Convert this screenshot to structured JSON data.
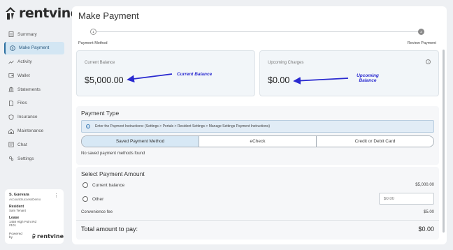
{
  "brand": {
    "name": "rentvine",
    "accent": "#2c6fa0"
  },
  "sidebar": {
    "items": [
      {
        "label": "Summary",
        "icon": "document-icon"
      },
      {
        "label": "Make Payment",
        "icon": "dollar-circle-icon",
        "active": true
      },
      {
        "label": "Activity",
        "icon": "activity-icon"
      },
      {
        "label": "Wallet",
        "icon": "wallet-icon"
      },
      {
        "label": "Statements",
        "icon": "bank-icon"
      },
      {
        "label": "Files",
        "icon": "file-icon"
      },
      {
        "label": "Insurance",
        "icon": "shield-icon"
      },
      {
        "label": "Maintenance",
        "icon": "maintenance-icon"
      },
      {
        "label": "Chat",
        "icon": "chat-icon"
      },
      {
        "label": "Settings",
        "icon": "settings-icon"
      }
    ]
  },
  "user_card": {
    "name": "S. Guevara",
    "account": "AccountSuccessDemo",
    "resident_label": "Resident",
    "resident_value": "Sam Tenant",
    "lease_label": "Lease",
    "lease_line1": "1458 High Point Rd",
    "lease_line2": "#101",
    "powered_by": "Powered by",
    "powered_logo": "rentvine"
  },
  "page": {
    "title": "Make Payment",
    "steps": [
      {
        "number": "1",
        "label": "Payment Method"
      },
      {
        "number": "2",
        "label": "Review Payment"
      }
    ]
  },
  "balances": {
    "current": {
      "label": "Current Balance",
      "value": "$5,000.00",
      "annotation": "Current Balance"
    },
    "upcoming": {
      "label": "Upcoming Charges",
      "value": "$0.00",
      "annotation_line1": "Upcoming",
      "annotation_line2": "Balance"
    }
  },
  "payment_type": {
    "title": "Payment Type",
    "info": "Enter the Payment Instructions: (Settings > Portals > Resident Settings > Manage Settings Payment Instructions)",
    "tabs": [
      "Saved Payment Method",
      "eCheck",
      "Credit or Debit Card"
    ],
    "active_tab": 0,
    "empty_message": "No saved payment methods found"
  },
  "amount": {
    "title": "Select Payment Amount",
    "current_label": "Current balance",
    "current_value": "$5,000.00",
    "other_label": "Other",
    "other_placeholder": "$0.00",
    "fee_label": "Convenience fee",
    "fee_value": "$5.00",
    "total_label": "Total amount to pay:",
    "total_value": "$0.00"
  },
  "annotation_color": "#2a2ad0"
}
